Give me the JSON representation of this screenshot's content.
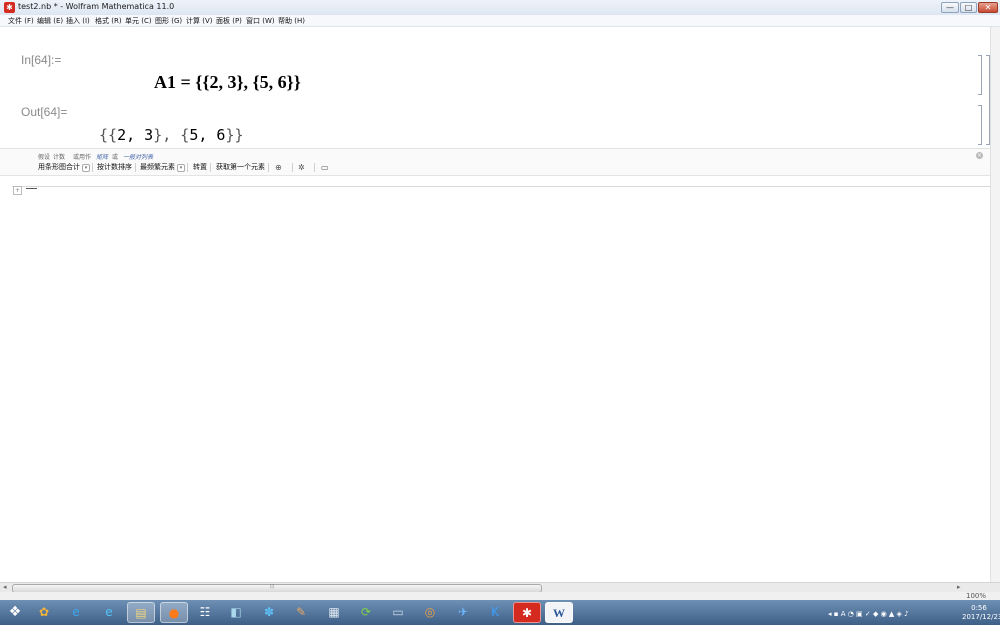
{
  "window": {
    "title": "test2.nb * - Wolfram Mathematica 11.0",
    "app_icon_glyph": "✱",
    "minimize_glyph": "—",
    "maximize_glyph": "□",
    "close_glyph": "✕"
  },
  "menu": {
    "items": [
      {
        "label": "文件 (F)"
      },
      {
        "label": "编辑 (E)"
      },
      {
        "label": "插入 (I)"
      },
      {
        "label": "格式 (R)"
      },
      {
        "label": "单元 (C)"
      },
      {
        "label": "图形 (G)"
      },
      {
        "label": "计算 (V)"
      },
      {
        "label": "面板 (P)"
      },
      {
        "label": "窗口 (W)"
      },
      {
        "label": "帮助 (H)"
      }
    ]
  },
  "notebook": {
    "input_label": "In[64]:=",
    "input_expr": "A1 = {{2, 3}, {5, 6}}",
    "output_label": "Out[64]=",
    "output_open": "{{",
    "output_2": "2",
    "output_sep1": ", ",
    "output_3": "3",
    "output_mid": "}, {",
    "output_5": "5",
    "output_sep2": ", ",
    "output_6": "6",
    "output_close": "}}"
  },
  "suggestions": {
    "row1_prefix": "假设",
    "row1_count": "计数",
    "row1_kind": "或用作",
    "row1_matrix": "矩阵",
    "row1_or": "或",
    "row1_list": "一般对列表",
    "buttons": [
      "用条形图合计",
      "按计数排序",
      "最频繁元素",
      "转置",
      "获取第一个元素"
    ],
    "close_glyph": "×",
    "drop_glyph": "▾",
    "search_glyph": "⊕",
    "gear_glyph": "✲",
    "chat_glyph": "▭"
  },
  "insert": {
    "plus_glyph": "+"
  },
  "hscroll": {
    "grip": "⦙⦙⦙",
    "left_glyph": "◂",
    "right_glyph": "▸"
  },
  "status": {
    "zoom": "100%"
  },
  "taskbar": {
    "start_glyph": "❖",
    "apps": [
      {
        "glyph": "✿",
        "color": "#f2b33a"
      },
      {
        "glyph": "e",
        "color": "#3da6f0"
      },
      {
        "glyph": "e",
        "color": "#4fc3f7"
      },
      {
        "glyph": "▤",
        "color": "#f0d680"
      },
      {
        "glyph": "●",
        "color": "#ff7a1a"
      },
      {
        "glyph": "☷",
        "color": "#ffffff"
      },
      {
        "glyph": "◧",
        "color": "#a8d8ea"
      },
      {
        "glyph": "✽",
        "color": "#5bc0f5"
      },
      {
        "glyph": "✎",
        "color": "#e9a760"
      },
      {
        "glyph": "▦",
        "color": "#dfe8f0"
      },
      {
        "glyph": "⟳",
        "color": "#7fd14a"
      },
      {
        "glyph": "▭",
        "color": "#c9d6e5"
      },
      {
        "glyph": "◎",
        "color": "#f0a040"
      },
      {
        "glyph": "✈",
        "color": "#6fb7ff"
      },
      {
        "glyph": "K",
        "color": "#3aa0ff"
      },
      {
        "glyph": "✱",
        "color": "#ffffff"
      },
      {
        "glyph": "W",
        "color": "#2b5797"
      }
    ],
    "tray": "◂ ▪ A ◔ ▣ ✓ ◆ ◉ ▲ ◈ ♪",
    "time": "0:56",
    "date": "2017/12/23"
  }
}
